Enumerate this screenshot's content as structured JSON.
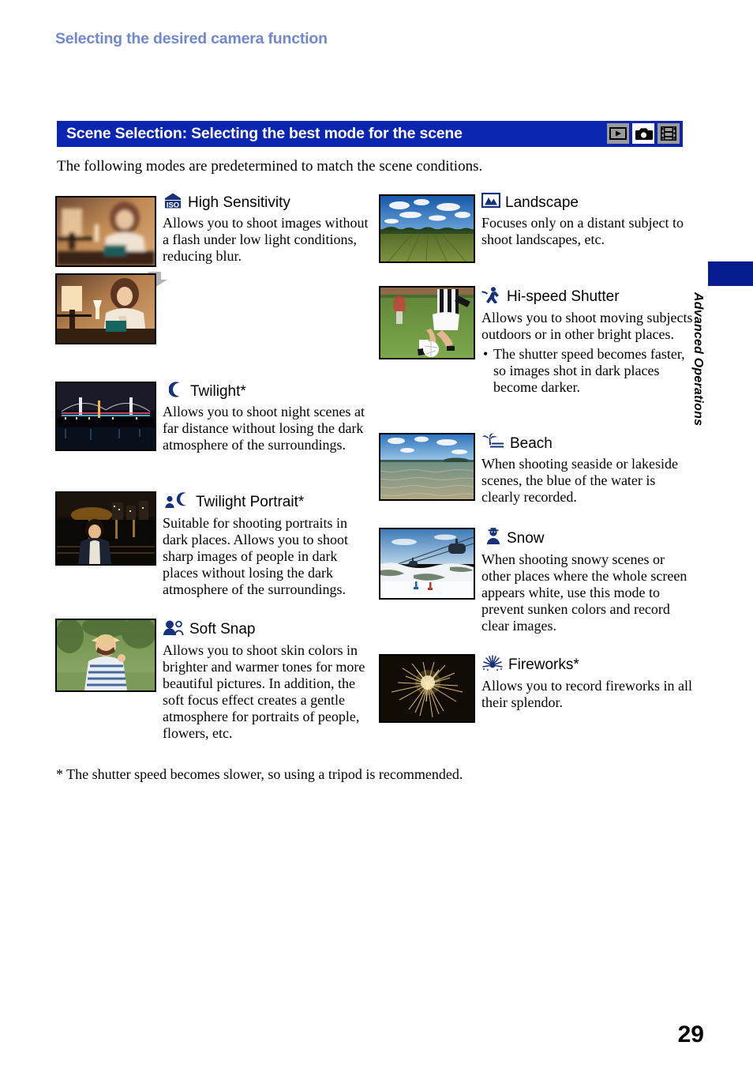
{
  "header": {
    "running_title": "Selecting the desired camera function"
  },
  "section": {
    "title": "Scene Selection: Selecting the best mode for the scene",
    "bar_color": "#0a26b0",
    "mode_icons": [
      {
        "name": "playback-mode-icon",
        "glyph": "play",
        "active": false
      },
      {
        "name": "still-camera-mode-icon",
        "glyph": "camera",
        "active": true
      },
      {
        "name": "movie-mode-icon",
        "glyph": "film",
        "active": false
      }
    ]
  },
  "intro": "The following modes are predetermined to match the scene conditions.",
  "left_column": [
    {
      "icon": "iso-icon",
      "title": "High Sensitivity",
      "description": "Allows you to shoot images without a flash under low light conditions, reducing blur.",
      "thumbnails": 2,
      "thumb_note": "blurred indoor portrait above, sharp indoor portrait below, gray down arrow between"
    },
    {
      "icon": "moon-icon",
      "title": "Twilight*",
      "description": "Allows you to shoot night scenes at far distance without losing the dark atmosphere of the surroundings.",
      "thumbnails": 1,
      "thumb_note": "night bridge cityscape"
    },
    {
      "icon": "person-moon-icon",
      "title": "Twilight Portrait*",
      "description": "Suitable for shooting portraits in dark places. Allows you to shoot sharp images of people in dark places without losing the dark atmosphere of the surroundings.",
      "thumbnails": 1,
      "thumb_note": "night portrait by waterfront"
    },
    {
      "icon": "two-people-icon",
      "title": "Soft Snap",
      "description": "Allows you to shoot skin colors in brighter and warmer tones for more beautiful pictures. In addition, the soft focus effect creates a gentle atmosphere for portraits of people, flowers, etc.",
      "thumbnails": 1,
      "thumb_note": "woman in straw hat outdoors"
    }
  ],
  "right_column": [
    {
      "icon": "mountain-icon",
      "title": "Landscape",
      "description": "Focuses only on a distant subject to shoot landscapes, etc.",
      "bullets": [],
      "thumbnails": 1,
      "thumb_note": "open green field with blue sky and clouds"
    },
    {
      "icon": "running-person-icon",
      "title": "Hi-speed Shutter",
      "description": "Allows you to shoot moving subjects outdoors or in other bright places.",
      "bullets": [
        "The shutter speed becomes faster, so images shot in dark places become darker."
      ],
      "thumbnails": 1,
      "thumb_note": "soccer player kicking ball on grass"
    },
    {
      "icon": "palm-tree-icon",
      "title": "Beach",
      "description": "When shooting seaside or lakeside scenes, the blue of the water is clearly recorded.",
      "bullets": [],
      "thumbnails": 1,
      "thumb_note": "shallow sea with distant shoreline"
    },
    {
      "icon": "snowman-icon",
      "title": "Snow",
      "description": "When shooting snowy scenes or other places where the whole screen appears white, use this mode to prevent sunken colors and record clear images.",
      "bullets": [],
      "thumbnails": 1,
      "thumb_note": "ski slope with gondola lift"
    },
    {
      "icon": "fireworks-icon",
      "title": "Fireworks*",
      "description": "Allows you to record fireworks in all their splendor.",
      "bullets": [],
      "thumbnails": 1,
      "thumb_note": "golden firework burst in night sky"
    }
  ],
  "footnote": "* The shutter speed becomes slower, so using a tripod is recommended.",
  "side_tab": {
    "label": "Advanced Operations",
    "block_color": "#061b8e"
  },
  "page_number": "29"
}
